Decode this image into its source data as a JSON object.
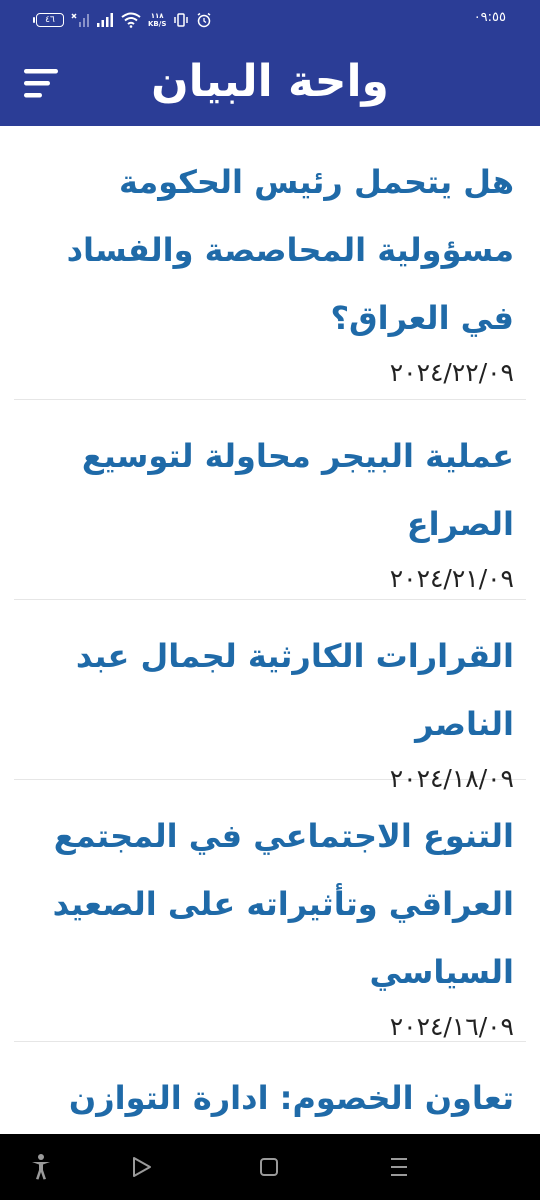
{
  "status_bar": {
    "battery": "٤٦",
    "net_speed_value": "١١٨",
    "net_speed_unit": "KB/S",
    "time": "٠٩:٥٥"
  },
  "app_bar": {
    "title": "واحة البيان",
    "menu_icon": "menu-icon"
  },
  "articles": [
    {
      "title": "هل يتحمل رئيس الحكومة مسؤولية المحاصصة والفساد في العراق؟",
      "date": "٢٠٢٤/٢٢/٠٩"
    },
    {
      "title": "عملية البيجر محاولة لتوسيع الصراع",
      "date": "٢٠٢٤/٢١/٠٩"
    },
    {
      "title": "القرارات الكارثية لجمال عبد الناصر",
      "date": "٢٠٢٤/١٨/٠٩"
    },
    {
      "title": "التنوع الاجتماعي في المجتمع العراقي وتأثيراته على الصعيد السياسي",
      "date": "٢٠٢٤/١٦/٠٩"
    },
    {
      "title": "تعاون الخصوم: ادارة التوازن",
      "date": ""
    }
  ],
  "nav_bar": {
    "icons": [
      "accessibility-icon",
      "back-icon",
      "home-icon",
      "recents-icon"
    ]
  },
  "colors": {
    "primary": "#2b3d96",
    "title_text": "#1f6aa8",
    "date_text": "#222222"
  }
}
